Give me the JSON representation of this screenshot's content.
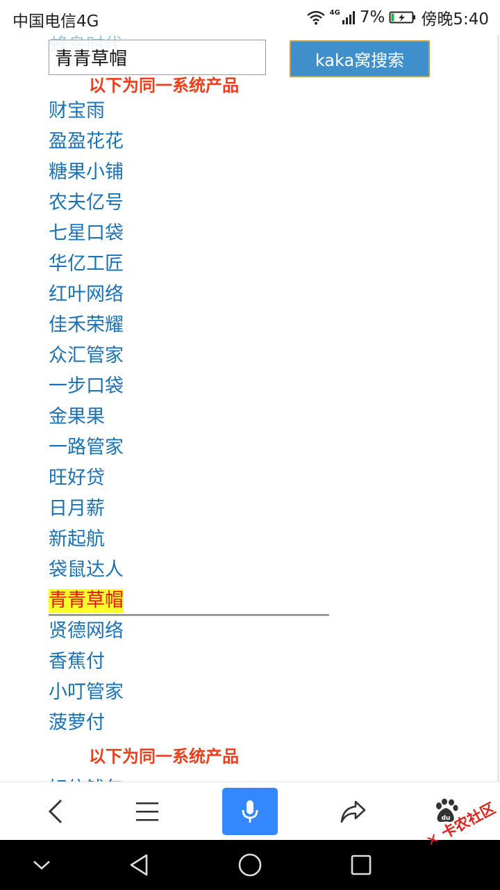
{
  "status_bar": {
    "carrier": "中国电信4G",
    "network": "4G",
    "battery": "7%",
    "time": "傍晚5:40"
  },
  "search": {
    "faded_text": "蜂鸟时代",
    "query": "青青草帽",
    "button_label": "kaka窝搜索"
  },
  "section_title": "以下为同一系统产品",
  "products": [
    "财宝雨",
    "盈盈花花",
    "糖果小铺",
    "农夫亿号",
    "七星口袋",
    "华亿工匠",
    "红叶网络",
    "佳禾荣耀",
    "众汇管家",
    "一步口袋",
    "金果果",
    "一路管家",
    "旺好贷",
    "日月薪",
    "新起航",
    "袋鼠达人",
    "青青草帽",
    "贤德网络",
    "香蕉付",
    "小叮管家",
    "菠萝付"
  ],
  "active_product": "青青草帽",
  "section_title_2": "以下为同一系统产品",
  "partial_item": "好信钱包",
  "toolbar": {
    "icons": [
      "back-icon",
      "menu-icon",
      "microphone-icon",
      "share-icon",
      "baidu-paw-icon"
    ]
  },
  "watermark": "卡农社区",
  "colors": {
    "link": "#1a72b6",
    "section_title": "#ee3d18",
    "highlight_bg": "#ffff2e",
    "highlight_text": "#e8130e",
    "button_bg": "#3f8fcc",
    "mic_bg": "#3388ff"
  }
}
